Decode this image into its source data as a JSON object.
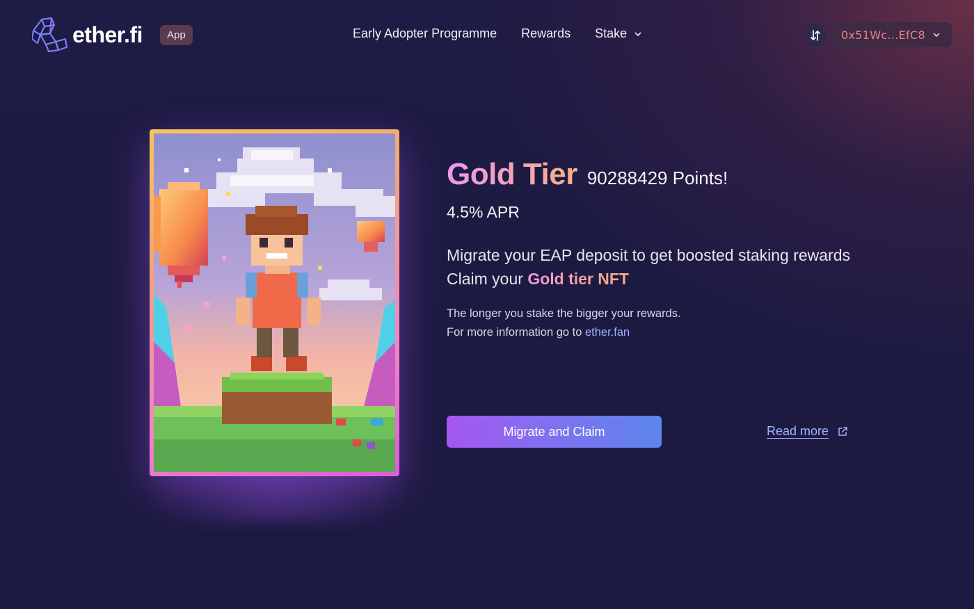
{
  "header": {
    "logo_text": "ether.fi",
    "badge": "App",
    "nav": [
      {
        "label": "Early Adopter Programme"
      },
      {
        "label": "Rewards"
      },
      {
        "label": "Stake",
        "icon": "chevron-down-icon"
      }
    ],
    "swap_icon": "swap-arrows-icon",
    "wallet": {
      "address": "0x51Wc...EfC8",
      "icon": "chevron-down-icon"
    }
  },
  "nft": {
    "icon": "pixel-art-adventurer-image"
  },
  "main": {
    "tier_title": "Gold Tier",
    "points": "90288429 Points!",
    "apr": "4.5% APR",
    "lead_line1": "Migrate your EAP deposit to get boosted staking rewards",
    "lead_line2_prefix": "Claim your ",
    "lead_line2_highlight": "Gold tier NFT",
    "info_line1": "The longer you stake the bigger your rewards.",
    "info_line2_prefix": "For more information go to ",
    "info_link": "ether.fan",
    "cta_label": "Migrate and Claim",
    "read_more_label": "Read more",
    "read_more_icon": "external-link-icon"
  },
  "colors": {
    "background": "#1e1b44",
    "wallet_text": "#f07f83",
    "link": "#9db2ff",
    "cta_start": "#a557f0",
    "cta_end": "#5c86ec"
  }
}
